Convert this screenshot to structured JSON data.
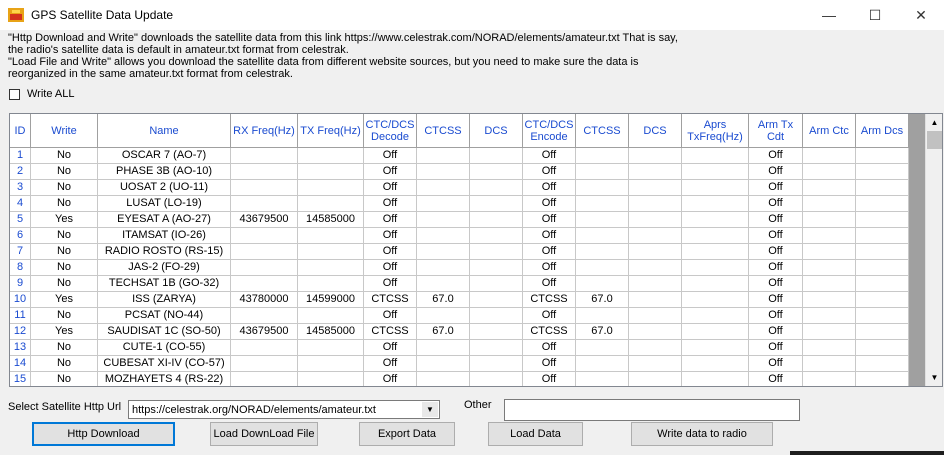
{
  "window": {
    "title": "GPS Satellite Data Update",
    "min": "—",
    "max": "☐",
    "close": "✕"
  },
  "description": {
    "line1": " \"Http Download and Write\" downloads the satellite data from this link  https://www.celestrak.com/NORAD/elements/amateur.txt That is say,",
    "line2": "the radio's satellite data is default in amateur.txt format from celestrak.",
    "line3": " \"Load File and Write\" allows you download the satellite data from different website sources, but you need to make sure the data is",
    "line4": "reorganized in the same amateur.txt format from celestrak."
  },
  "write_all_label": "Write ALL",
  "table": {
    "headers": [
      "ID",
      "Write",
      "Name",
      "RX Freq(Hz)",
      "TX Freq(Hz)",
      "CTC/DCS Decode",
      "CTCSS",
      "DCS",
      "CTC/DCS Encode",
      "CTCSS",
      "DCS",
      "Aprs TxFreq(Hz)",
      "Arm Tx Cdt",
      "Arm Ctc",
      "Arm Dcs"
    ],
    "rows": [
      [
        "1",
        "No",
        "OSCAR 7 (AO-7)",
        "",
        "",
        "Off",
        "",
        "",
        "Off",
        "",
        "",
        "",
        "Off",
        "",
        ""
      ],
      [
        "2",
        "No",
        "PHASE 3B (AO-10)",
        "",
        "",
        "Off",
        "",
        "",
        "Off",
        "",
        "",
        "",
        "Off",
        "",
        ""
      ],
      [
        "3",
        "No",
        "UOSAT 2 (UO-11)",
        "",
        "",
        "Off",
        "",
        "",
        "Off",
        "",
        "",
        "",
        "Off",
        "",
        ""
      ],
      [
        "4",
        "No",
        "LUSAT (LO-19)",
        "",
        "",
        "Off",
        "",
        "",
        "Off",
        "",
        "",
        "",
        "Off",
        "",
        ""
      ],
      [
        "5",
        "Yes",
        "EYESAT A (AO-27)",
        "43679500",
        "14585000",
        "Off",
        "",
        "",
        "Off",
        "",
        "",
        "",
        "Off",
        "",
        ""
      ],
      [
        "6",
        "No",
        "ITAMSAT (IO-26)",
        "",
        "",
        "Off",
        "",
        "",
        "Off",
        "",
        "",
        "",
        "Off",
        "",
        ""
      ],
      [
        "7",
        "No",
        "RADIO ROSTO (RS-15)",
        "",
        "",
        "Off",
        "",
        "",
        "Off",
        "",
        "",
        "",
        "Off",
        "",
        ""
      ],
      [
        "8",
        "No",
        "JAS-2 (FO-29)",
        "",
        "",
        "Off",
        "",
        "",
        "Off",
        "",
        "",
        "",
        "Off",
        "",
        ""
      ],
      [
        "9",
        "No",
        "TECHSAT 1B (GO-32)",
        "",
        "",
        "Off",
        "",
        "",
        "Off",
        "",
        "",
        "",
        "Off",
        "",
        ""
      ],
      [
        "10",
        "Yes",
        "ISS (ZARYA)",
        "43780000",
        "14599000",
        "CTCSS",
        "67.0",
        "",
        "CTCSS",
        "67.0",
        "",
        "",
        "Off",
        "",
        ""
      ],
      [
        "11",
        "No",
        "PCSAT (NO-44)",
        "",
        "",
        "Off",
        "",
        "",
        "Off",
        "",
        "",
        "",
        "Off",
        "",
        ""
      ],
      [
        "12",
        "Yes",
        "SAUDISAT 1C (SO-50)",
        "43679500",
        "14585000",
        "CTCSS",
        "67.0",
        "",
        "CTCSS",
        "67.0",
        "",
        "",
        "Off",
        "",
        ""
      ],
      [
        "13",
        "No",
        "CUTE-1 (CO-55)",
        "",
        "",
        "Off",
        "",
        "",
        "Off",
        "",
        "",
        "",
        "Off",
        "",
        ""
      ],
      [
        "14",
        "No",
        "CUBESAT XI-IV (CO-57)",
        "",
        "",
        "Off",
        "",
        "",
        "Off",
        "",
        "",
        "",
        "Off",
        "",
        ""
      ],
      [
        "15",
        "No",
        "MOZHAYETS 4 (RS-22)",
        "",
        "",
        "Off",
        "",
        "",
        "Off",
        "",
        "",
        "",
        "Off",
        "",
        ""
      ]
    ]
  },
  "url_label": "Select Satellite Http Url",
  "url_value": "https://celestrak.org/NORAD/elements/amateur.txt",
  "other_label": "Other",
  "buttons": {
    "http_download": "Http Download",
    "load_download_file": "Load DownLoad File",
    "export_data": "Export Data",
    "load_data": "Load  Data",
    "write_to_radio": "Write data to radio"
  },
  "colors": {
    "header_text": "#1a4bd0",
    "accent": "#0078d7"
  }
}
